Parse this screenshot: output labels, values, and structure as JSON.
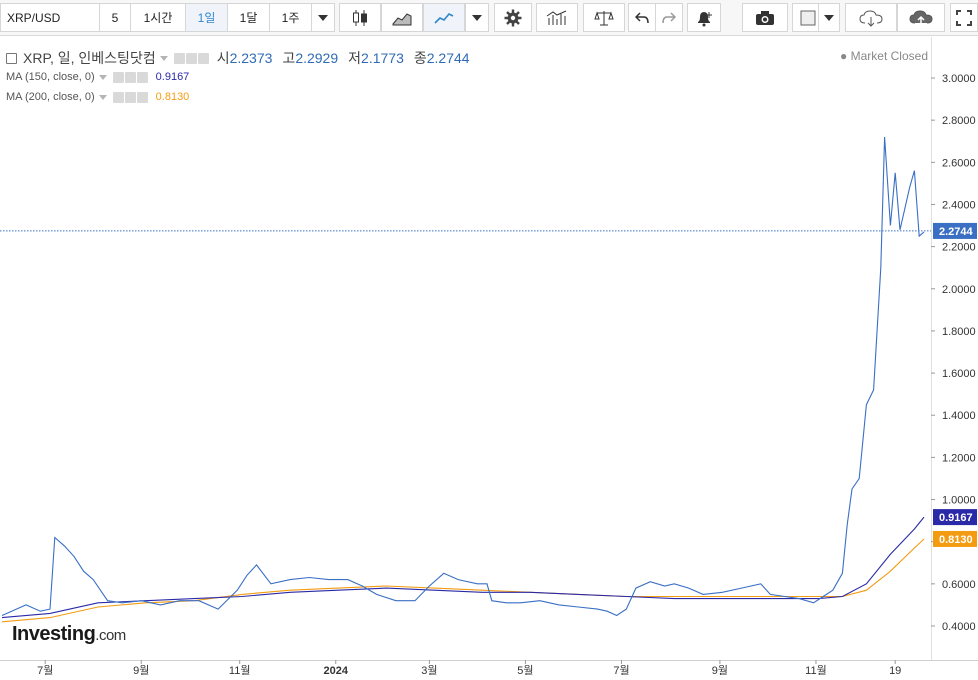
{
  "toolbar": {
    "symbol": "XRP/USD",
    "intervals": [
      "5",
      "1시간",
      "1일",
      "1달",
      "1주"
    ],
    "active_interval": "1일"
  },
  "legend": {
    "title": "XRP, 일, 인베스팅닷컴",
    "open_label": "시",
    "open": "2.2373",
    "high_label": "고",
    "high": "2.2929",
    "low_label": "저",
    "low": "2.1773",
    "close_label": "종",
    "close": "2.2744",
    "ma150": {
      "label": "MA (150, close, 0)",
      "value": "0.9167",
      "color": "#2a2aa8"
    },
    "ma200": {
      "label": "MA (200, close, 0)",
      "value": "0.8130",
      "color": "#f39c12"
    },
    "status": "Market Closed"
  },
  "branding": {
    "logo_main": "Investing",
    "logo_suffix": ".com"
  },
  "colors": {
    "price_line": "#3a6fc4",
    "ma150": "#2a2aa8",
    "ma200": "#f39c12",
    "last_price_tag": "#3a6fc4"
  },
  "chart_data": {
    "type": "line",
    "title": "XRP, 일, 인베스팅닷컴",
    "ylim": [
      0.35,
      3.05
    ],
    "y_ticks": [
      "3.0000",
      "2.8000",
      "2.6000",
      "2.4000",
      "2.2000",
      "2.0000",
      "1.8000",
      "1.6000",
      "1.4000",
      "1.2000",
      "1.0000",
      "0.8000",
      "0.6000",
      "0.4000"
    ],
    "x_ticks": [
      {
        "label": "7월",
        "t": 0.9
      },
      {
        "label": "9월",
        "t": 2.9
      },
      {
        "label": "11월",
        "t": 4.95
      },
      {
        "label": "2024",
        "t": 6.95
      },
      {
        "label": "3월",
        "t": 8.9
      },
      {
        "label": "5월",
        "t": 10.9
      },
      {
        "label": "7월",
        "t": 12.9
      },
      {
        "label": "9월",
        "t": 14.95
      },
      {
        "label": "11월",
        "t": 16.95
      },
      {
        "label": "19",
        "t": 18.6
      }
    ],
    "last_price": 2.2744,
    "series": [
      {
        "name": "XRP",
        "points": [
          [
            0,
            0.45
          ],
          [
            0.3,
            0.48
          ],
          [
            0.5,
            0.5
          ],
          [
            0.8,
            0.47
          ],
          [
            1.0,
            0.48
          ],
          [
            1.1,
            0.82
          ],
          [
            1.3,
            0.78
          ],
          [
            1.5,
            0.73
          ],
          [
            1.7,
            0.66
          ],
          [
            1.9,
            0.62
          ],
          [
            2.2,
            0.52
          ],
          [
            2.5,
            0.51
          ],
          [
            2.9,
            0.52
          ],
          [
            3.3,
            0.5
          ],
          [
            3.7,
            0.52
          ],
          [
            4.1,
            0.52
          ],
          [
            4.5,
            0.48
          ],
          [
            4.9,
            0.57
          ],
          [
            5.1,
            0.64
          ],
          [
            5.3,
            0.69
          ],
          [
            5.6,
            0.6
          ],
          [
            6.0,
            0.62
          ],
          [
            6.4,
            0.63
          ],
          [
            6.8,
            0.62
          ],
          [
            7.2,
            0.62
          ],
          [
            7.5,
            0.59
          ],
          [
            7.8,
            0.55
          ],
          [
            8.2,
            0.52
          ],
          [
            8.6,
            0.52
          ],
          [
            8.9,
            0.59
          ],
          [
            9.2,
            0.65
          ],
          [
            9.5,
            0.62
          ],
          [
            9.9,
            0.6
          ],
          [
            10.1,
            0.6
          ],
          [
            10.2,
            0.52
          ],
          [
            10.5,
            0.51
          ],
          [
            10.8,
            0.51
          ],
          [
            11.2,
            0.52
          ],
          [
            11.6,
            0.5
          ],
          [
            12.0,
            0.49
          ],
          [
            12.4,
            0.48
          ],
          [
            12.6,
            0.47
          ],
          [
            12.8,
            0.45
          ],
          [
            13.0,
            0.48
          ],
          [
            13.2,
            0.58
          ],
          [
            13.5,
            0.61
          ],
          [
            13.8,
            0.59
          ],
          [
            14.0,
            0.6
          ],
          [
            14.3,
            0.58
          ],
          [
            14.6,
            0.55
          ],
          [
            15.0,
            0.56
          ],
          [
            15.4,
            0.58
          ],
          [
            15.8,
            0.6
          ],
          [
            16.0,
            0.55
          ],
          [
            16.3,
            0.54
          ],
          [
            16.6,
            0.53
          ],
          [
            16.9,
            0.51
          ],
          [
            17.1,
            0.54
          ],
          [
            17.3,
            0.57
          ],
          [
            17.5,
            0.65
          ],
          [
            17.6,
            0.88
          ],
          [
            17.7,
            1.05
          ],
          [
            17.85,
            1.1
          ],
          [
            18.0,
            1.45
          ],
          [
            18.15,
            1.52
          ],
          [
            18.3,
            2.1
          ],
          [
            18.38,
            2.72
          ],
          [
            18.5,
            2.3
          ],
          [
            18.6,
            2.55
          ],
          [
            18.7,
            2.28
          ],
          [
            18.8,
            2.38
          ],
          [
            18.9,
            2.48
          ],
          [
            19.0,
            2.56
          ],
          [
            19.1,
            2.25
          ],
          [
            19.2,
            2.27
          ]
        ]
      },
      {
        "name": "MA (150, close, 0)",
        "points": [
          [
            0,
            0.44
          ],
          [
            1.0,
            0.46
          ],
          [
            2.0,
            0.51
          ],
          [
            3.0,
            0.52
          ],
          [
            4.0,
            0.53
          ],
          [
            5.0,
            0.54
          ],
          [
            6.0,
            0.56
          ],
          [
            7.0,
            0.57
          ],
          [
            8.0,
            0.58
          ],
          [
            9.0,
            0.57
          ],
          [
            10.0,
            0.56
          ],
          [
            11.0,
            0.56
          ],
          [
            12.0,
            0.55
          ],
          [
            13.0,
            0.54
          ],
          [
            14.0,
            0.53
          ],
          [
            15.0,
            0.53
          ],
          [
            16.0,
            0.53
          ],
          [
            17.0,
            0.53
          ],
          [
            17.5,
            0.54
          ],
          [
            18.0,
            0.6
          ],
          [
            18.5,
            0.74
          ],
          [
            19.0,
            0.86
          ],
          [
            19.2,
            0.9167
          ]
        ]
      },
      {
        "name": "MA (200, close, 0)",
        "points": [
          [
            0,
            0.42
          ],
          [
            1.0,
            0.44
          ],
          [
            2.0,
            0.49
          ],
          [
            3.0,
            0.51
          ],
          [
            4.0,
            0.52
          ],
          [
            5.0,
            0.55
          ],
          [
            6.0,
            0.57
          ],
          [
            7.0,
            0.58
          ],
          [
            8.0,
            0.59
          ],
          [
            9.0,
            0.58
          ],
          [
            10.0,
            0.57
          ],
          [
            11.0,
            0.56
          ],
          [
            12.0,
            0.55
          ],
          [
            13.0,
            0.54
          ],
          [
            14.0,
            0.54
          ],
          [
            15.0,
            0.54
          ],
          [
            16.0,
            0.54
          ],
          [
            17.0,
            0.54
          ],
          [
            17.5,
            0.54
          ],
          [
            18.0,
            0.57
          ],
          [
            18.5,
            0.66
          ],
          [
            19.0,
            0.77
          ],
          [
            19.2,
            0.813
          ]
        ]
      }
    ]
  }
}
